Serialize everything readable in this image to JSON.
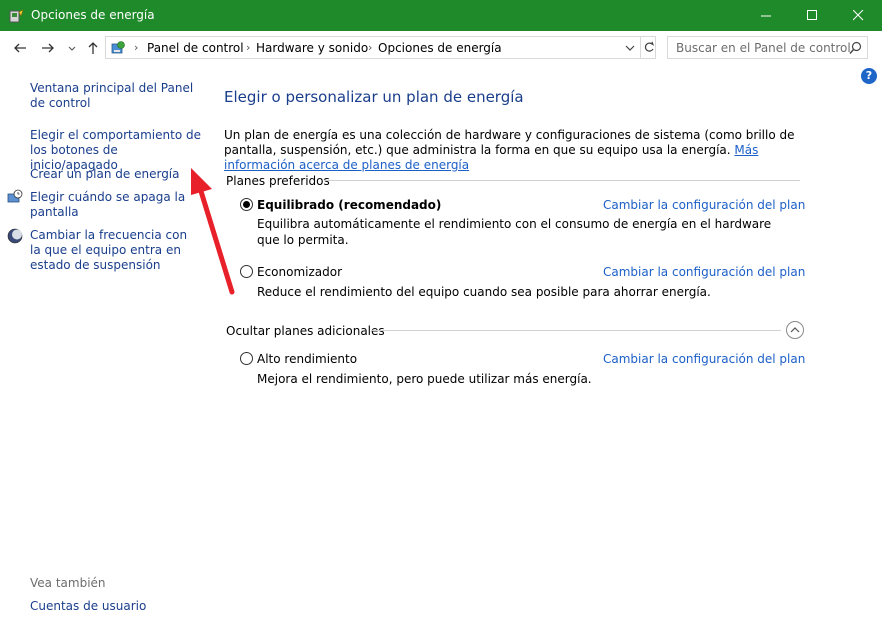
{
  "window": {
    "title": "Opciones de energía"
  },
  "breadcrumb": [
    "Panel de control",
    "Hardware y sonido",
    "Opciones de energía"
  ],
  "search": {
    "placeholder": "Buscar en el Panel de control"
  },
  "help": {
    "glyph": "?"
  },
  "sidebar": {
    "items": [
      {
        "label": "Ventana principal del Panel de control"
      },
      {
        "label": "Elegir el comportamiento de los botones de inicio/apagado"
      },
      {
        "label": "Crear un plan de energía"
      },
      {
        "label": "Elegir cuándo se apaga la pantalla"
      },
      {
        "label": "Cambiar la frecuencia con la que el equipo entra en estado de suspensión"
      }
    ],
    "see_also_label": "Vea también",
    "see_also_items": [
      {
        "label": "Cuentas de usuario"
      }
    ]
  },
  "main": {
    "title": "Elegir o personalizar un plan de energía",
    "intro": "Un plan de energía es una colección de hardware y configuraciones de sistema (como brillo de pantalla, suspensión, etc.) que administra la forma en que su equipo usa la energía.",
    "intro_link": "Más información acerca de planes de energía",
    "preferred_label": "Planes preferidos",
    "additional_label": "Ocultar planes adicionales",
    "change_link_label": "Cambiar la configuración del plan",
    "plans": [
      {
        "name": "Equilibrado (recomendado)",
        "description": "Equilibra automáticamente el rendimiento con el consumo de energía en el hardware que lo permita.",
        "selected": true
      },
      {
        "name": "Economizador",
        "description": "Reduce el rendimiento del equipo cuando sea posible para ahorrar energía.",
        "selected": false
      },
      {
        "name": "Alto rendimiento",
        "description": "Mejora el rendimiento, pero puede utilizar más energía.",
        "selected": false
      }
    ]
  },
  "colors": {
    "titlebar": "#1e8a2a",
    "heading": "#1a3e8c",
    "link": "#1c5fc7",
    "annotation_arrow": "#e8202a"
  }
}
